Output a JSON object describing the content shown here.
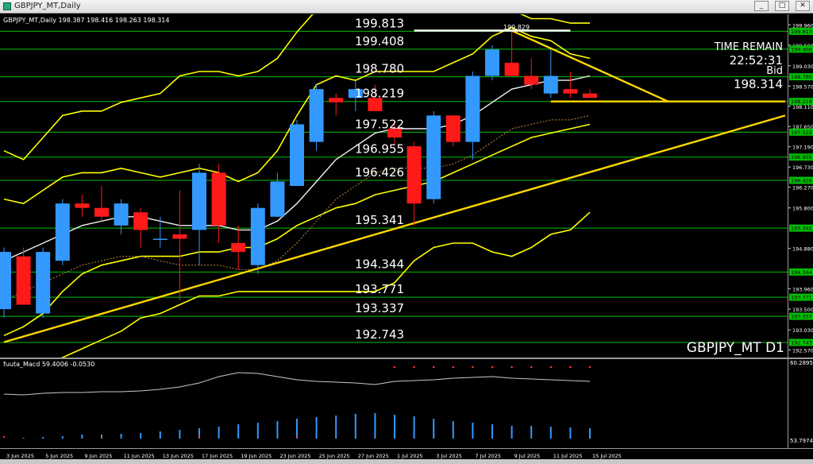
{
  "window": {
    "title": "GBPJPY_MT,Daily",
    "buttons": [
      "_",
      "□",
      "✕"
    ]
  },
  "chart": {
    "header": "GBPJPY_MT,Daily  198.387 198.416 198.263 198.314",
    "watermark": "GBPJPY_MT D1",
    "time_remain_label": "TIME REMAIN",
    "time_remain_value": "22:52:31",
    "bid_label": "Bid",
    "bid_value": "198.314",
    "high_marker": "199.829",
    "levels": [
      {
        "price": 199.813,
        "label": "199.813"
      },
      {
        "price": 199.408,
        "label": "199.408"
      },
      {
        "price": 198.78,
        "label": "198.780"
      },
      {
        "price": 198.219,
        "label": "198.219"
      },
      {
        "price": 197.522,
        "label": "197.522"
      },
      {
        "price": 196.955,
        "label": "196.955"
      },
      {
        "price": 196.426,
        "label": "196.426"
      },
      {
        "price": 195.341,
        "label": "195.341"
      },
      {
        "price": 194.344,
        "label": "194.344"
      },
      {
        "price": 193.771,
        "label": "193.771"
      },
      {
        "price": 193.337,
        "label": "193.337"
      },
      {
        "price": 192.743,
        "label": "192.743"
      }
    ],
    "axis_ticks": [
      "199.960",
      "199.500",
      "199.030",
      "198.570",
      "198.110",
      "197.650",
      "197.190",
      "196.730",
      "196.270",
      "195.800",
      "194.880",
      "193.960",
      "193.500",
      "193.030",
      "192.570"
    ],
    "colors": {
      "bull": "#3399ff",
      "bear": "#ff1a1a",
      "level_line": "#00c000",
      "level_tag": "#00c000",
      "trendline": "#ffd800",
      "bands": "#ffff00",
      "ma": "#ffffff"
    }
  },
  "chart_data": {
    "type": "candlestick",
    "xlabel": "",
    "ylabel": "",
    "ylim": [
      192.4,
      200.2
    ],
    "dates": [
      "3 Jun 2025",
      "5 Jun 2025",
      "9 Jun 2025",
      "11 Jun 2025",
      "13 Jun 2025",
      "17 Jun 2025",
      "19 Jun 2025",
      "23 Jun 2025",
      "25 Jun 2025",
      "27 Jun 2025",
      "1 Jul 2025",
      "3 Jul 2025",
      "7 Jul 2025",
      "9 Jul 2025",
      "11 Jul 2025",
      "15 Jul 2025"
    ],
    "candles": [
      {
        "open": 193.5,
        "high": 194.9,
        "low": 193.3,
        "close": 194.8
      },
      {
        "open": 194.7,
        "high": 194.9,
        "low": 193.6,
        "close": 193.6
      },
      {
        "open": 193.4,
        "high": 194.9,
        "low": 193.3,
        "close": 194.8
      },
      {
        "open": 194.6,
        "high": 196.0,
        "low": 194.5,
        "close": 195.9
      },
      {
        "open": 195.9,
        "high": 196.1,
        "low": 195.6,
        "close": 195.8
      },
      {
        "open": 195.8,
        "high": 196.3,
        "low": 195.5,
        "close": 195.6
      },
      {
        "open": 195.4,
        "high": 196.0,
        "low": 195.2,
        "close": 195.9
      },
      {
        "open": 195.7,
        "high": 195.8,
        "low": 194.9,
        "close": 195.3
      },
      {
        "open": 195.1,
        "high": 195.6,
        "low": 194.9,
        "close": 195.1
      },
      {
        "open": 195.2,
        "high": 196.2,
        "low": 193.7,
        "close": 195.1
      },
      {
        "open": 195.3,
        "high": 196.8,
        "low": 194.5,
        "close": 196.6
      },
      {
        "open": 196.6,
        "high": 196.8,
        "low": 195.0,
        "close": 195.4
      },
      {
        "open": 195.0,
        "high": 195.4,
        "low": 194.4,
        "close": 194.8
      },
      {
        "open": 194.5,
        "high": 195.9,
        "low": 194.3,
        "close": 195.8
      },
      {
        "open": 195.6,
        "high": 196.6,
        "low": 195.6,
        "close": 196.4
      },
      {
        "open": 196.3,
        "high": 197.8,
        "low": 196.3,
        "close": 197.7
      },
      {
        "open": 197.3,
        "high": 198.6,
        "low": 197.1,
        "close": 198.5
      },
      {
        "open": 198.3,
        "high": 198.4,
        "low": 197.9,
        "close": 198.2
      },
      {
        "open": 198.3,
        "high": 198.7,
        "low": 198.0,
        "close": 198.5
      },
      {
        "open": 198.3,
        "high": 198.6,
        "low": 198.0,
        "close": 198.0
      },
      {
        "open": 197.6,
        "high": 197.8,
        "low": 197.2,
        "close": 197.4
      },
      {
        "open": 197.2,
        "high": 197.3,
        "low": 195.4,
        "close": 195.9
      },
      {
        "open": 196.0,
        "high": 198.0,
        "low": 195.9,
        "close": 197.9
      },
      {
        "open": 197.9,
        "high": 197.9,
        "low": 197.2,
        "close": 197.3
      },
      {
        "open": 197.3,
        "high": 198.9,
        "low": 196.9,
        "close": 198.8
      },
      {
        "open": 198.8,
        "high": 199.5,
        "low": 198.7,
        "close": 199.4
      },
      {
        "open": 199.1,
        "high": 199.8,
        "low": 198.8,
        "close": 198.8
      },
      {
        "open": 198.8,
        "high": 199.2,
        "low": 198.5,
        "close": 198.6
      },
      {
        "open": 198.4,
        "high": 199.4,
        "low": 198.3,
        "close": 198.8
      },
      {
        "open": 198.5,
        "high": 198.9,
        "low": 198.3,
        "close": 198.4
      },
      {
        "open": 198.4,
        "high": 198.5,
        "low": 198.3,
        "close": 198.3
      }
    ],
    "bands": {
      "upper_outer": [
        197.1,
        196.9,
        197.4,
        197.9,
        198.0,
        198.0,
        198.2,
        198.3,
        198.4,
        198.8,
        198.9,
        198.9,
        198.8,
        198.9,
        199.2,
        199.8,
        200.3,
        200.5,
        200.3,
        200.3,
        200.5,
        200.4,
        200.4,
        200.3,
        200.4,
        200.6,
        200.3,
        200.1,
        200.1,
        200.0,
        200.0
      ],
      "upper_inner": [
        196.0,
        195.9,
        196.2,
        196.5,
        196.6,
        196.6,
        196.7,
        196.6,
        196.5,
        196.6,
        196.7,
        196.6,
        196.4,
        196.6,
        197.1,
        197.9,
        198.6,
        198.8,
        198.7,
        198.9,
        198.9,
        198.9,
        198.9,
        199.1,
        199.3,
        199.7,
        199.9,
        199.7,
        199.6,
        199.3,
        199.2
      ],
      "ma": [
        194.6,
        194.8,
        195.0,
        195.2,
        195.4,
        195.5,
        195.6,
        195.6,
        195.5,
        195.4,
        195.4,
        195.4,
        195.3,
        195.3,
        195.5,
        195.9,
        196.4,
        196.9,
        197.2,
        197.5,
        197.6,
        197.6,
        197.6,
        197.7,
        197.9,
        198.2,
        198.5,
        198.6,
        198.7,
        198.7,
        198.8
      ],
      "lower_inner": [
        192.9,
        193.1,
        193.4,
        193.9,
        194.3,
        194.5,
        194.6,
        194.7,
        194.7,
        194.7,
        194.8,
        194.8,
        194.9,
        194.9,
        195.1,
        195.4,
        195.6,
        195.8,
        195.9,
        196.1,
        196.2,
        196.3,
        196.4,
        196.6,
        196.8,
        197.0,
        197.2,
        197.4,
        197.5,
        197.6,
        197.7
      ],
      "lower_outer": [
        192.0,
        192.1,
        192.2,
        192.4,
        192.6,
        192.8,
        193.0,
        193.3,
        193.4,
        193.6,
        193.8,
        193.8,
        193.9,
        193.9,
        193.9,
        193.9,
        193.9,
        193.9,
        193.9,
        193.9,
        194.1,
        194.6,
        194.9,
        195.0,
        195.0,
        194.8,
        194.7,
        194.9,
        195.2,
        195.3,
        195.7
      ]
    },
    "trendlines": [
      {
        "name": "support",
        "from": {
          "i": 0,
          "price": 192.75
        },
        "to": {
          "i": 40,
          "price": 197.9
        }
      },
      {
        "name": "resistance",
        "from": {
          "i": 26,
          "price": 199.829
        },
        "to": {
          "i": 34,
          "price": 198.22
        }
      },
      {
        "name": "high_line",
        "from": {
          "i": 21,
          "price": 199.83
        },
        "to": {
          "i": 29,
          "price": 199.83
        }
      },
      {
        "name": "bid_line",
        "from": {
          "i": 28,
          "price": 198.22
        },
        "to": {
          "i": 40,
          "price": 198.22
        }
      }
    ],
    "subwindow": {
      "label": "fuuta_Macd 59.4006 -0.0530",
      "ticks": [
        "60.2895",
        "53.7974"
      ],
      "line": [
        44,
        45,
        43,
        42,
        42,
        41,
        41,
        40,
        38,
        35,
        30,
        22,
        17,
        18,
        22,
        26,
        28,
        29,
        30,
        32,
        28,
        27,
        26,
        24,
        23,
        22,
        24,
        25,
        26,
        27,
        28
      ],
      "hist": [
        0,
        1,
        2,
        3,
        5,
        5,
        6,
        7,
        9,
        11,
        13,
        15,
        18,
        20,
        22,
        25,
        27,
        29,
        31,
        32,
        30,
        28,
        25,
        22,
        20,
        18,
        16,
        16,
        15,
        14,
        13
      ],
      "dots_red_top": [
        20,
        21,
        22,
        23,
        24,
        25,
        26,
        27,
        28,
        29,
        30
      ]
    }
  }
}
